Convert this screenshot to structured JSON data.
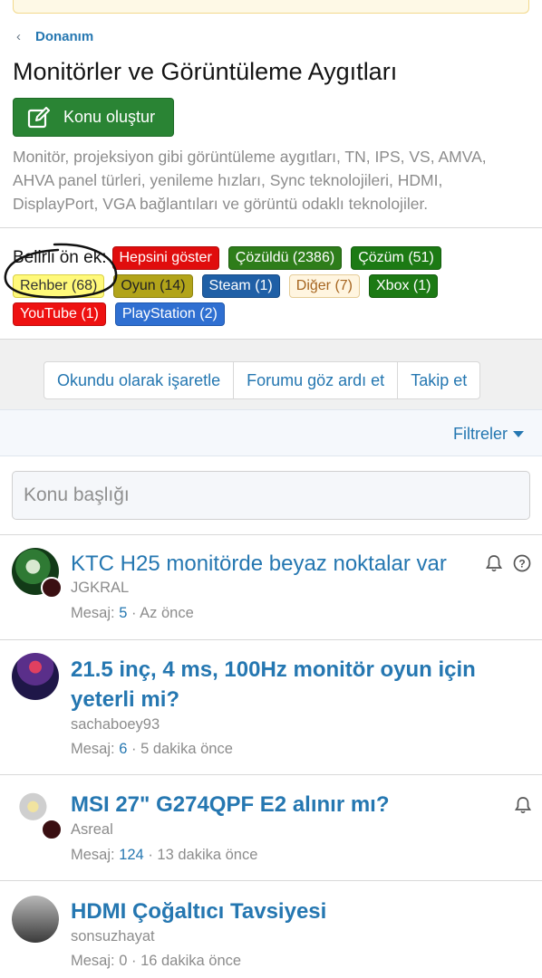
{
  "breadcrumb": {
    "label": "Donanım"
  },
  "page": {
    "title": "Monitörler ve Görüntüleme Aygıtları",
    "create_button": "Konu oluştur",
    "description": "Monitör, projeksiyon gibi görüntüleme aygıtları, TN, IPS, VS, AMVA, AHVA panel türleri, yenileme hızları, Sync teknolojileri, HDMI, DisplayPort, VGA bağlantıları ve görüntü odaklı teknolojiler."
  },
  "prefixes": {
    "label": "Belirli ön ek:",
    "tags": [
      {
        "label": "Hepsini göster"
      },
      {
        "label": "Çözüldü (2386)"
      },
      {
        "label": "Çözüm (51)"
      },
      {
        "label": "Rehber (68)"
      },
      {
        "label": "Oyun (14)"
      },
      {
        "label": "Steam (1)"
      },
      {
        "label": "Diğer (7)"
      },
      {
        "label": "Xbox (1)"
      },
      {
        "label": "YouTube (1)"
      },
      {
        "label": "PlayStation (2)"
      }
    ]
  },
  "actions": {
    "mark_read": "Okundu olarak işaretle",
    "ignore": "Forumu göz ardı et",
    "follow": "Takip et"
  },
  "filters": {
    "label": "Filtreler"
  },
  "search": {
    "placeholder": "Konu başlığı"
  },
  "threads": [
    {
      "title": "KTC H25 monitörde beyaz noktalar var",
      "author": "JGKRAL",
      "meta_label": "Mesaj:",
      "replies": "5",
      "time": "· Az önce"
    },
    {
      "title_line1": "21.5 inç, 4 ms, 100Hz monitör oyun için",
      "title_line2": "yeterli mi?",
      "author": "sachaboey93",
      "meta_label": "Mesaj:",
      "replies": "6",
      "time": "· 5 dakika önce"
    },
    {
      "title": "MSI 27\" G274QPF E2 alınır mı?",
      "author": "Asreal",
      "meta_label": "Mesaj:",
      "replies": "124",
      "time": "· 13 dakika önce"
    },
    {
      "title": "HDMI Çoğaltıcı Tavsiyesi",
      "author": "sonsuzhayat",
      "meta_label": "Mesaj:",
      "replies": "0",
      "time": "· 16 dakika önce"
    }
  ],
  "icons": {
    "back": "chevron-left-icon",
    "create": "edit-icon",
    "watch": "bell-icon",
    "question": "question-circle-icon",
    "filters_caret": "caret-down-icon"
  },
  "colors": {
    "link": "#2577b1",
    "create_button": "#2a8434",
    "muted": "#8c8c8c"
  }
}
